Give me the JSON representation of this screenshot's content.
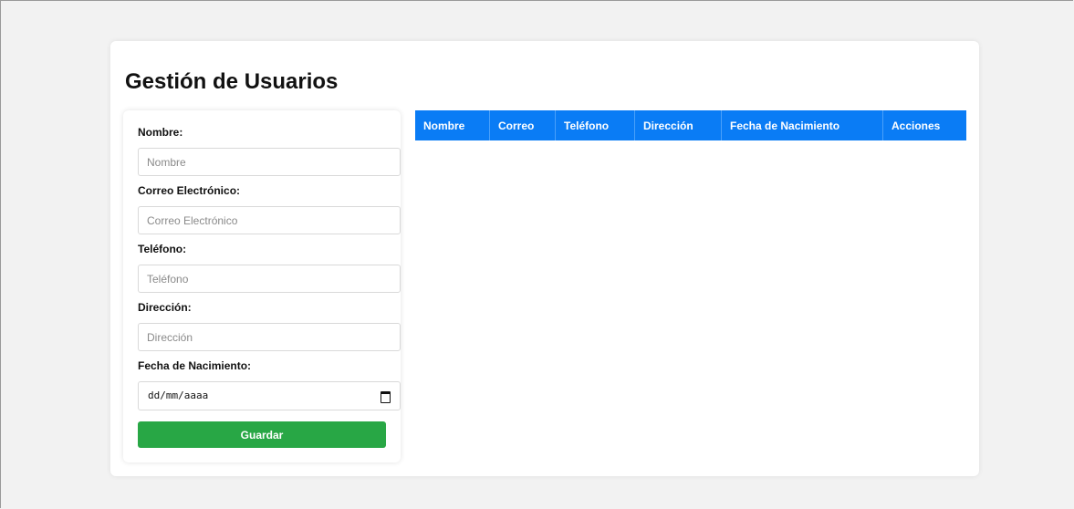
{
  "page": {
    "title": "Gestión de Usuarios"
  },
  "form": {
    "fields": [
      {
        "label": "Nombre:",
        "placeholder": "Nombre"
      },
      {
        "label": "Correo Electrónico:",
        "placeholder": "Correo Electrónico"
      },
      {
        "label": "Teléfono:",
        "placeholder": "Teléfono"
      },
      {
        "label": "Dirección:",
        "placeholder": "Dirección"
      }
    ],
    "birthdate": {
      "label": "Fecha de Nacimiento:",
      "placeholder": "dd/mm/aaaa",
      "icon": "calendar-icon"
    },
    "submit_label": "Guardar"
  },
  "table": {
    "headers": [
      "Nombre",
      "Correo",
      "Teléfono",
      "Dirección",
      "Fecha de Nacimiento",
      "Acciones"
    ],
    "rows": []
  },
  "colors": {
    "table_header": "#0a7cf5",
    "save_button": "#28a745",
    "background": "#f2f2f2"
  }
}
